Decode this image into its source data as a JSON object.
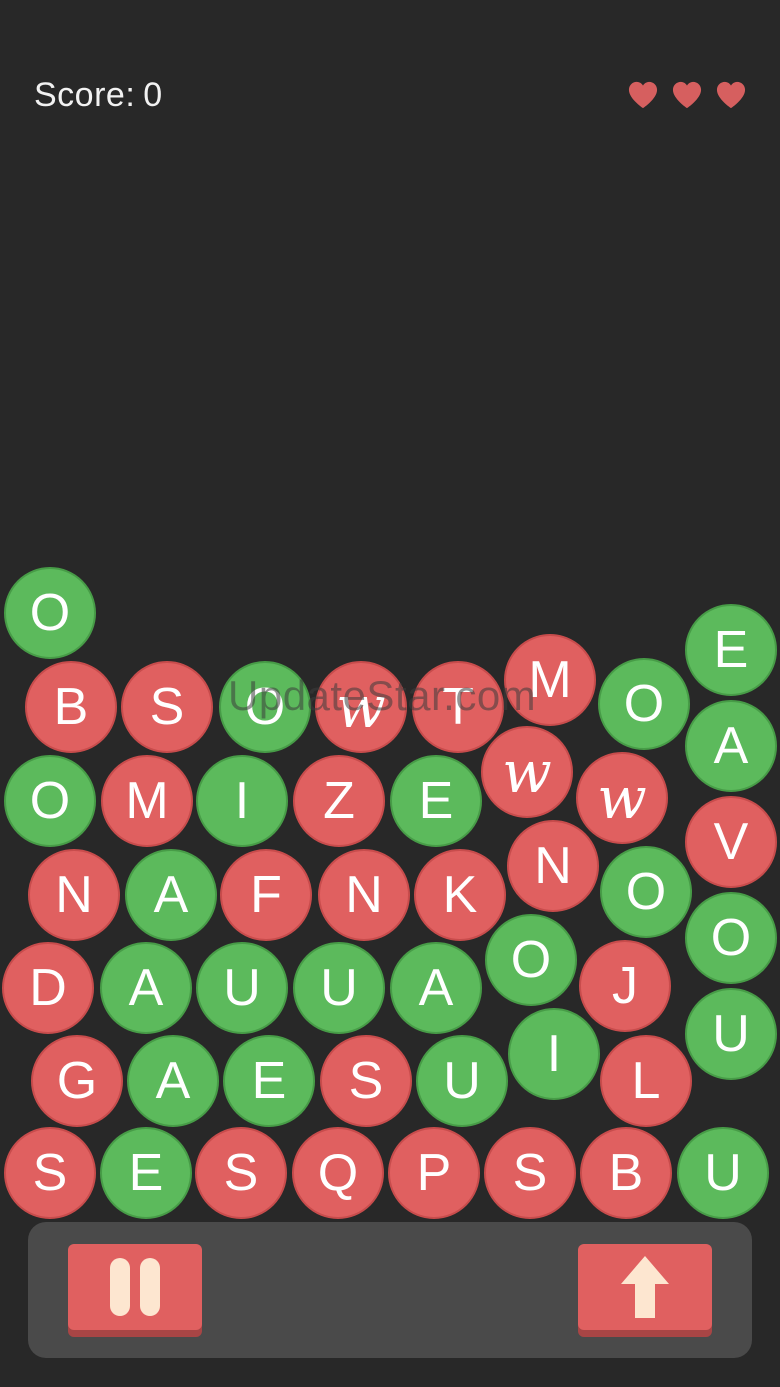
{
  "hud": {
    "score_label": "Score:",
    "score_value": "0",
    "lives": 3,
    "lives_icon": "heart-icon",
    "heart_color": "#d65f5f"
  },
  "colors": {
    "background": "#282828",
    "red_ball": "#e06060",
    "green_ball": "#5cba5c",
    "bar": "#4a4a4a",
    "button": "#e06060",
    "button_icon": "#fde6d0"
  },
  "watermark": "UpdateStar.com",
  "controls": {
    "pause_icon": "pause-icon",
    "launch_icon": "arrow-up-icon"
  },
  "balls": [
    {
      "letter": "O",
      "color": "green"
    },
    {
      "letter": "E",
      "color": "green"
    },
    {
      "letter": "B",
      "color": "red"
    },
    {
      "letter": "S",
      "color": "red"
    },
    {
      "letter": "O",
      "color": "green"
    },
    {
      "letter": "w",
      "color": "red",
      "special": true
    },
    {
      "letter": "T",
      "color": "red"
    },
    {
      "letter": "M",
      "color": "red"
    },
    {
      "letter": "O",
      "color": "green"
    },
    {
      "letter": "A",
      "color": "green"
    },
    {
      "letter": "O",
      "color": "green"
    },
    {
      "letter": "M",
      "color": "red"
    },
    {
      "letter": "I",
      "color": "green"
    },
    {
      "letter": "Z",
      "color": "red"
    },
    {
      "letter": "E",
      "color": "green"
    },
    {
      "letter": "w",
      "color": "red",
      "special": true
    },
    {
      "letter": "w",
      "color": "red",
      "special": true
    },
    {
      "letter": "V",
      "color": "red"
    },
    {
      "letter": "N",
      "color": "red"
    },
    {
      "letter": "A",
      "color": "green"
    },
    {
      "letter": "F",
      "color": "red"
    },
    {
      "letter": "N",
      "color": "red"
    },
    {
      "letter": "K",
      "color": "red"
    },
    {
      "letter": "N",
      "color": "red"
    },
    {
      "letter": "O",
      "color": "green"
    },
    {
      "letter": "O",
      "color": "green"
    },
    {
      "letter": "D",
      "color": "red"
    },
    {
      "letter": "A",
      "color": "green"
    },
    {
      "letter": "U",
      "color": "green"
    },
    {
      "letter": "U",
      "color": "green"
    },
    {
      "letter": "A",
      "color": "green"
    },
    {
      "letter": "O",
      "color": "green"
    },
    {
      "letter": "J",
      "color": "red"
    },
    {
      "letter": "U",
      "color": "green"
    },
    {
      "letter": "G",
      "color": "red"
    },
    {
      "letter": "A",
      "color": "green"
    },
    {
      "letter": "E",
      "color": "green"
    },
    {
      "letter": "S",
      "color": "red"
    },
    {
      "letter": "U",
      "color": "green"
    },
    {
      "letter": "I",
      "color": "green"
    },
    {
      "letter": "L",
      "color": "red"
    },
    {
      "letter": "S",
      "color": "red"
    },
    {
      "letter": "E",
      "color": "green"
    },
    {
      "letter": "S",
      "color": "red"
    },
    {
      "letter": "Q",
      "color": "red"
    },
    {
      "letter": "P",
      "color": "red"
    },
    {
      "letter": "S",
      "color": "red"
    },
    {
      "letter": "B",
      "color": "red"
    },
    {
      "letter": "U",
      "color": "green"
    }
  ]
}
